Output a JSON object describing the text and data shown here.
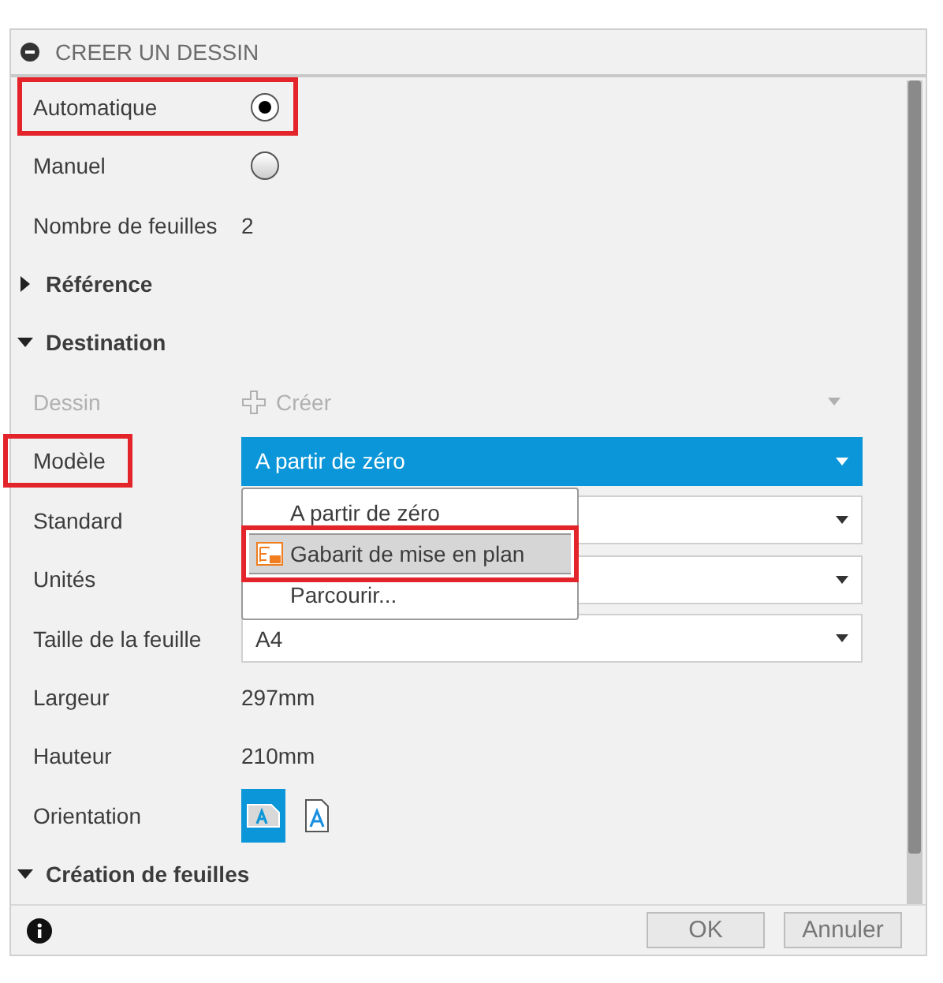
{
  "panel": {
    "title": "CREER UN DESSIN"
  },
  "rows": [
    {
      "kind": "radio",
      "label": "Automatique",
      "selected": true,
      "highlighted": true
    },
    {
      "kind": "radio",
      "label": "Manuel",
      "selected": false,
      "highlighted": false
    },
    {
      "kind": "text",
      "label": "Nombre de feuilles",
      "value": "2"
    },
    {
      "kind": "section",
      "label": "Référence",
      "expanded": false
    },
    {
      "kind": "section",
      "label": "Destination",
      "expanded": true
    },
    {
      "kind": "action",
      "label": "Dessin",
      "value": "Créer",
      "disabled": true
    },
    {
      "kind": "dropdown",
      "label": "Modèle",
      "value": "A partir de zéro",
      "active": true,
      "highlighted": true,
      "menu": [
        {
          "kind": "plain",
          "label": "A partir de zéro",
          "hovered": false,
          "highlighted": false
        },
        {
          "kind": "template",
          "label": "Gabarit de mise en plan",
          "hovered": true,
          "highlighted": true
        },
        {
          "kind": "plain",
          "label": "Parcourir...",
          "hovered": false,
          "highlighted": false
        }
      ]
    },
    {
      "kind": "dropdown",
      "label": "Standard",
      "active": false
    },
    {
      "kind": "dropdown",
      "label": "Unités",
      "active": false
    },
    {
      "kind": "dropdown",
      "label": "Taille de la feuille",
      "value": "A4",
      "active": false
    },
    {
      "kind": "text",
      "label": "Largeur",
      "value": "297mm"
    },
    {
      "kind": "text",
      "label": "Hauteur",
      "value": "210mm"
    },
    {
      "kind": "orientation",
      "label": "Orientation",
      "options": [
        {
          "kind": "landscape",
          "selected": true
        },
        {
          "kind": "portrait",
          "selected": false
        }
      ]
    },
    {
      "kind": "section",
      "label": "Création de feuilles",
      "expanded": true
    }
  ],
  "footer": {
    "buttons": [
      "OK",
      "Annuler"
    ]
  }
}
